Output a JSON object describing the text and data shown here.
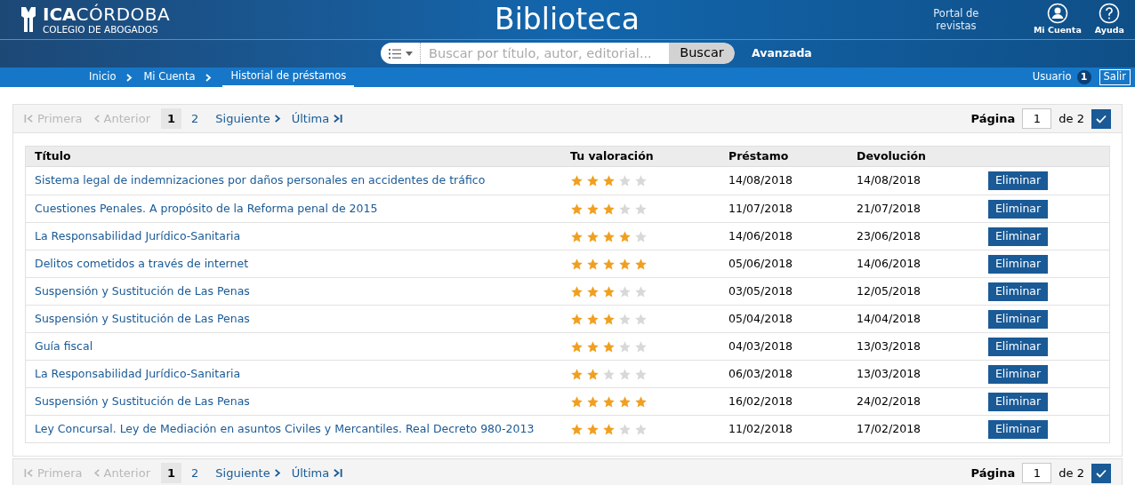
{
  "header": {
    "logo": {
      "mark": "ICA",
      "name": "CÓRDOBA",
      "subtitle": "COLEGIO DE ABOGADOS"
    },
    "title": "Biblioteca",
    "portal_link": "Portal de revistas",
    "account": "Mi Cuenta",
    "help": "Ayuda"
  },
  "search": {
    "placeholder": "Buscar por título, autor, editorial...",
    "button": "Buscar",
    "advanced": "Avanzada"
  },
  "breadcrumb": [
    {
      "label": "Inicio",
      "selected": false
    },
    {
      "label": "Mi Cuenta",
      "selected": false
    },
    {
      "label": "Historial de préstamos",
      "selected": true
    }
  ],
  "user": {
    "label": "Usuario",
    "count": "1",
    "logout": "Salir"
  },
  "pagination_top": {
    "first": {
      "label": "Primera",
      "disabled": true
    },
    "prev": {
      "label": "Anterior",
      "disabled": true
    },
    "pages": [
      {
        "label": "1",
        "selected": true
      },
      {
        "label": "2",
        "selected": false
      }
    ],
    "next": {
      "label": "Siguiente",
      "disabled": false
    },
    "last": {
      "label": "Última",
      "disabled": false
    },
    "page_label": "Página",
    "page_value": "1",
    "of": "de 2"
  },
  "table": {
    "columns": [
      "Título",
      "Tu valoración",
      "Préstamo",
      "Devolución"
    ],
    "rows": [
      {
        "title": "Sistema legal de indemnizaciones por daños personales en accidentes de tráfico",
        "stars": 3,
        "loan": "14/08/2018",
        "return": "14/08/2018",
        "action": "Eliminar"
      },
      {
        "title": "Cuestiones Penales. A propósito de la Reforma penal de 2015",
        "stars": 3,
        "loan": "11/07/2018",
        "return": "21/07/2018",
        "action": "Eliminar"
      },
      {
        "title": "La Responsabilidad Jurídico-Sanitaria",
        "stars": 4,
        "loan": "14/06/2018",
        "return": "23/06/2018",
        "action": "Eliminar"
      },
      {
        "title": "Delitos cometidos a través de internet",
        "stars": 5,
        "loan": "05/06/2018",
        "return": "14/06/2018",
        "action": "Eliminar"
      },
      {
        "title": "Suspensión y Sustitución de Las Penas",
        "stars": 3,
        "loan": "03/05/2018",
        "return": "12/05/2018",
        "action": "Eliminar"
      },
      {
        "title": "Suspensión y Sustitución de Las Penas",
        "stars": 3,
        "loan": "05/04/2018",
        "return": "14/04/2018",
        "action": "Eliminar"
      },
      {
        "title": "Guía fiscal",
        "stars": 3,
        "loan": "04/03/2018",
        "return": "13/03/2018",
        "action": "Eliminar"
      },
      {
        "title": "La Responsabilidad Jurídico-Sanitaria",
        "stars": 2,
        "loan": "06/03/2018",
        "return": "13/03/2018",
        "action": "Eliminar"
      },
      {
        "title": "Suspensión y Sustitución de Las Penas",
        "stars": 5,
        "loan": "16/02/2018",
        "return": "24/02/2018",
        "action": "Eliminar"
      },
      {
        "title": "Ley Concursal. Ley de Mediación en asuntos Civiles y Mercantiles. Real Decreto 980-2013",
        "stars": 3,
        "loan": "11/02/2018",
        "return": "17/02/2018",
        "action": "Eliminar"
      }
    ]
  },
  "pagination_bottom": {
    "first": {
      "label": "Primera",
      "disabled": true
    },
    "prev": {
      "label": "Anterior",
      "disabled": true
    },
    "pages": [
      {
        "label": "1",
        "selected": true
      },
      {
        "label": "2",
        "selected": false
      }
    ],
    "next": {
      "label": "Siguiente",
      "disabled": false
    },
    "last": {
      "label": "Última",
      "disabled": false
    },
    "page_label": "Página",
    "page_value": "1",
    "of": "de 2"
  }
}
